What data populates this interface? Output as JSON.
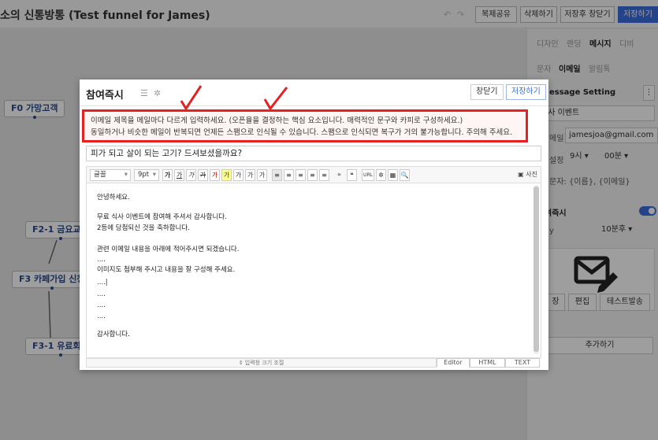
{
  "app": {
    "title": "소의 신통방통 (Test funnel for James)",
    "undo_icon": "↶",
    "redo_icon": "↷",
    "buttons": {
      "copy_share": "복제공유",
      "delete": "삭제하기",
      "save_close": "저장후 창닫기",
      "save": "저장하기"
    }
  },
  "canvas": {
    "nodes": [
      {
        "label": "F0 가망고객"
      },
      {
        "label": "F2-1 금요교육"
      },
      {
        "label": "F3 카페가입 신청"
      },
      {
        "label": "F3-1 유료회원"
      }
    ]
  },
  "right_panel": {
    "tabs": [
      "디자인",
      "랜딩",
      "메시지",
      "디비"
    ],
    "active_tab": "메시지",
    "subtabs": [
      "문자",
      "이메일",
      "알림톡"
    ],
    "active_subtab": "이메일",
    "section_title": "essage Setting",
    "name_value": "식사 이벤트",
    "email_label": "메일",
    "email_value": "jamesjoa@gmail.com",
    "time_label": "설정",
    "hour": "9시",
    "minute": "00분",
    "var_hint": "문자: {이름}, {이메일}",
    "toggle_label": "여즉시",
    "delay_label": "y",
    "delay_value": "10분후",
    "actions": {
      "save": "장",
      "edit": "편집",
      "test_send": "테스트발송"
    },
    "add_button": "추가하기"
  },
  "modal": {
    "title": "참여즉시",
    "icons": [
      "list-icon",
      "gear-icon"
    ],
    "list_glyph": "☰",
    "gear_glyph": "✲",
    "close_label": "창닫기",
    "save_label": "저장하기",
    "warning": [
      "이메일 제목을 메일마다 다르게 입력하세요. (오픈율을 결정하는 핵심 요소입니다. 매력적인 문구와 카피로 구성하세요.)",
      "동일하거나 비슷한 메일이 반복되면 언제든 스팸으로 인식될 수 있습니다. 스팸으로 인식되면 복구가 거의 불가능합니다. 주의해 주세요."
    ],
    "subject": "피가 되고 살이 되는 고기? 드셔보셨을까요?",
    "toolbar": {
      "font_family": "글꼴",
      "font_size": "9pt",
      "buttons": [
        "가",
        "가",
        "가",
        "가",
        "가",
        "가",
        "가",
        "가",
        "가",
        "≡",
        "≡",
        "≡",
        "≡",
        "≡",
        "»",
        "❝",
        "URL",
        "✲",
        "▦",
        "🔍"
      ],
      "photo": "사진"
    },
    "body": [
      "안녕하세요.",
      "무료 식사 이벤트에 참여해 주셔서 감사합니다.",
      "2등에 당첨되신 것을 축하합니다.",
      "관련 이메일 내용을 아래에 적어주시면 되겠습니다.",
      "....",
      "이미지도 첨부해 주시고 내용을 잘 구성해 주세요.",
      "....|",
      "....",
      "....",
      "....",
      "감사합니다."
    ],
    "resize_label": "⇕ 입력창 크기 조절",
    "modes": [
      "Editor",
      "HTML",
      "TEXT"
    ]
  },
  "colors": {
    "accent": "#3d6ddb",
    "warning_border": "#e52222",
    "node_text": "#2a4a8a"
  }
}
